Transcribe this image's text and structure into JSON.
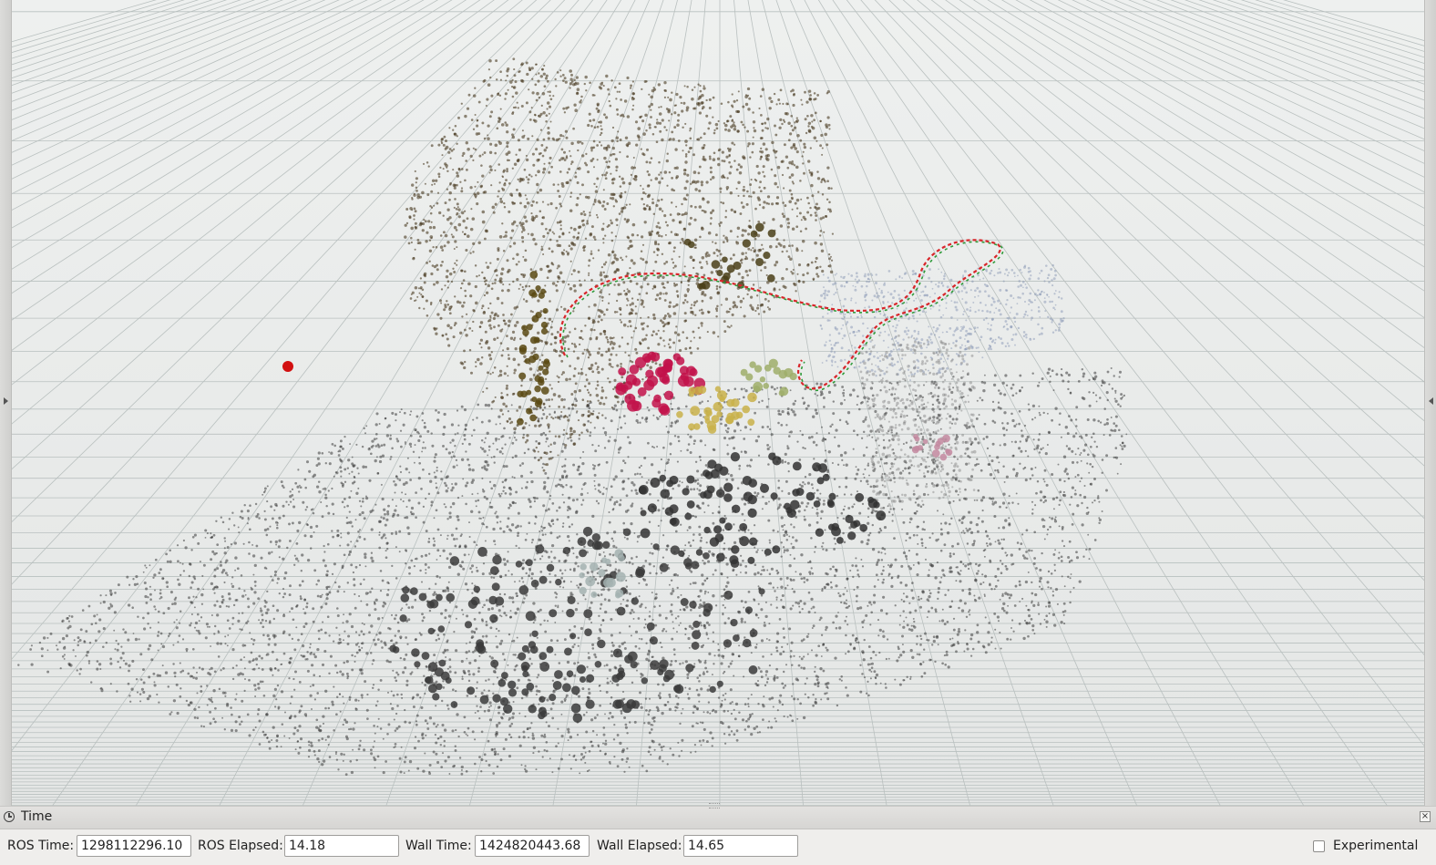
{
  "time_panel": {
    "title": "Time",
    "icon": "clock-icon",
    "close_icon": "close-icon",
    "ros_time_label": "ROS Time:",
    "ros_time_value": "1298112296.10",
    "ros_elapsed_label": "ROS Elapsed:",
    "ros_elapsed_value": "14.18",
    "wall_time_label": "Wall Time:",
    "wall_time_value": "1424820443.68",
    "wall_elapsed_label": "Wall Elapsed:",
    "wall_elapsed_value": "14.65",
    "experimental_label": "Experimental",
    "experimental_checked": false
  },
  "viewport": {
    "background_color": "#e6e8e7",
    "grid_color": "#b9c0bf",
    "point_cloud_color": "#3a3a3a",
    "trajectory_colors": [
      "#d8262a",
      "#2f9a3a"
    ],
    "marker_color": "#d21010"
  }
}
